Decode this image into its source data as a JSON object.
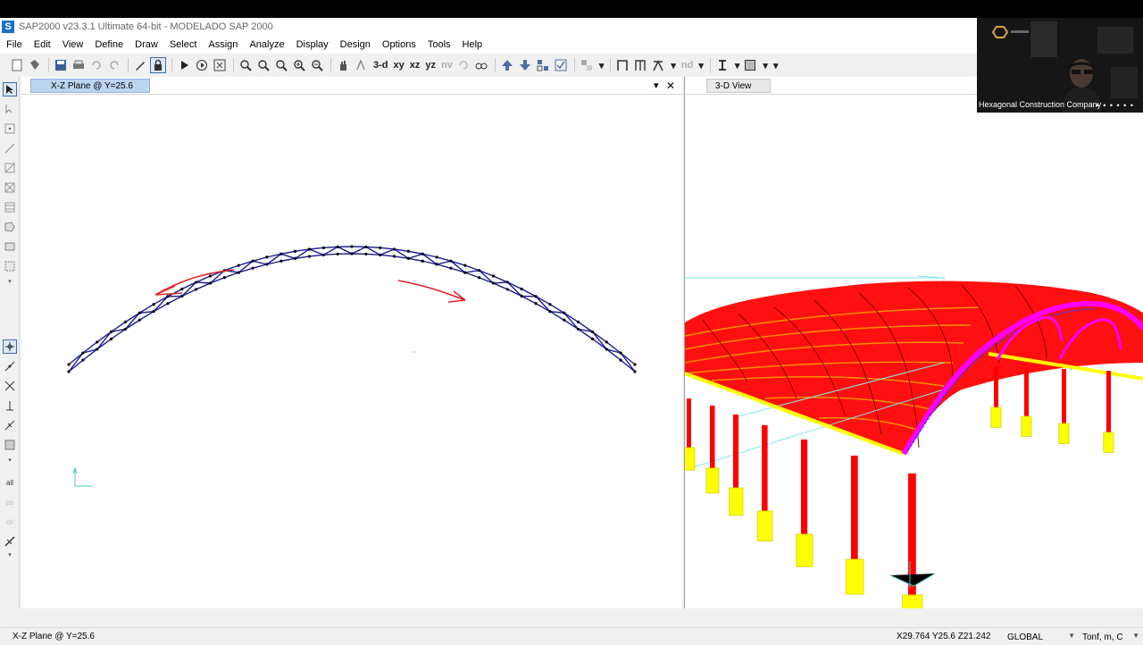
{
  "window": {
    "title": "SAP2000 v23.3.1 Ultimate 64-bit - MODELADO SAP 2000",
    "app_icon_letter": "S"
  },
  "menu": [
    "File",
    "Edit",
    "View",
    "Define",
    "Draw",
    "Select",
    "Assign",
    "Analyze",
    "Display",
    "Design",
    "Options",
    "Tools",
    "Help"
  ],
  "toolbar": {
    "view_3d": "3-d",
    "view_xy": "xy",
    "view_xz": "xz",
    "view_yz": "yz",
    "view_nv": "nv",
    "nd": "nd",
    "dropdown_glyph": "▾"
  },
  "left_pane": {
    "tab_label": "X-Z Plane @ Y=25.6",
    "dropdown_glyph": "▾",
    "close_glyph": "✕"
  },
  "right_pane": {
    "tab_label": "3-D View"
  },
  "status": {
    "view_label": "X-Z Plane @ Y=25.6",
    "coordinates": "X29.764  Y25.6  Z21.242",
    "coord_system": "GLOBAL",
    "units": "Tonf, m, C"
  },
  "webcam": {
    "name": "Hexagonal Construction Company",
    "more_dots": "• • • • • •"
  },
  "colors": {
    "truss_member": "#1a1a8c",
    "truss_joint": "#000000",
    "annotation_red": "#e0242a",
    "shell_red": "#ff0000",
    "frame_yellow": "#ffff00",
    "arch_magenta": "#ff00ff",
    "axis_cyan": "#00d0d0",
    "tab_active_bg": "#bcd5ef"
  }
}
